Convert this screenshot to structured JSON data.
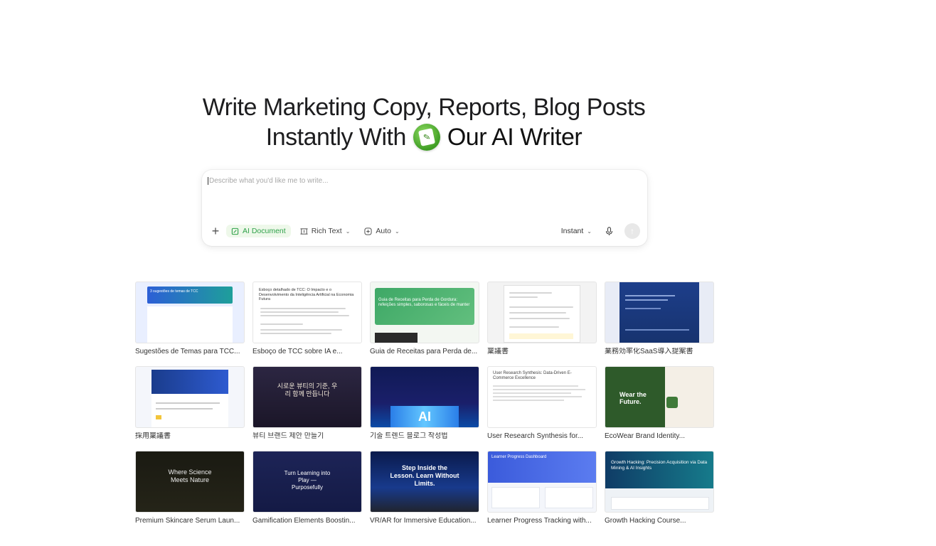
{
  "hero": {
    "line1": "Write Marketing Copy, Reports, Blog Posts",
    "line2_prefix": "Instantly With",
    "line2_strong": "Our AI Writer",
    "logo_icon": "ai-writer-logo-icon"
  },
  "composer": {
    "placeholder": "Describe what you'd like me to write...",
    "plus_label": "+",
    "chips": [
      {
        "label": "AI Document",
        "icon": "document-icon",
        "active": true
      },
      {
        "label": "Rich Text",
        "icon": "rich-text-icon",
        "active": false
      },
      {
        "label": "Auto",
        "icon": "plus-square-icon",
        "active": false
      }
    ],
    "mode_label": "Instant"
  },
  "gallery": [
    {
      "title": "Sugestões de Temas para TCC...",
      "thumb_text": "3 sugestões de temas de TCC"
    },
    {
      "title": "Esboço de TCC sobre IA e...",
      "thumb_text": "Esboço detalhado de TCC: O Impacto e o Desenvolvimento da Inteligência Artificial na Economia Futura"
    },
    {
      "title": "Guia de Receitas para Perda de...",
      "thumb_text": "Guia de Receitas para Perda de Gordura: refeições simples, saborosas e fáceis de manter"
    },
    {
      "title": "稟議書",
      "thumb_text": ""
    },
    {
      "title": "業務効率化SaaS導入提案書",
      "thumb_text": ""
    },
    {
      "title": "採用稟議書",
      "thumb_text": ""
    },
    {
      "title": "뷰티 브랜드 제안 만들기",
      "thumb_text": "시로운 뷰티의 기준, 우리 함께 만듭니다"
    },
    {
      "title": "기술 트렌드 블로그 작성법",
      "thumb_text": "AI"
    },
    {
      "title": "User Research Synthesis for...",
      "thumb_text": "User Research Synthesis: Data-Driven E-Commerce Excellence"
    },
    {
      "title": "EcoWear Brand Identity...",
      "thumb_text": "Wear the Future."
    },
    {
      "title": "Premium Skincare Serum Laun...",
      "thumb_text": "Where Science Meets Nature"
    },
    {
      "title": "Gamification Elements Boostin...",
      "thumb_text": "Turn Learning into Play — Purposefully"
    },
    {
      "title": "VR/AR for Immersive Education...",
      "thumb_text": "Step Inside the Lesson. Learn Without Limits."
    },
    {
      "title": "Learner Progress Tracking with...",
      "thumb_text": "Learner Progress Dashboard"
    },
    {
      "title": "Growth Hacking Course...",
      "thumb_text": "Growth Hacking: Precision Acquisition via Data Mining & AI Insights"
    }
  ],
  "colors": {
    "accent_green": "#2fa14a",
    "active_chip_bg": "#eef8ea"
  }
}
